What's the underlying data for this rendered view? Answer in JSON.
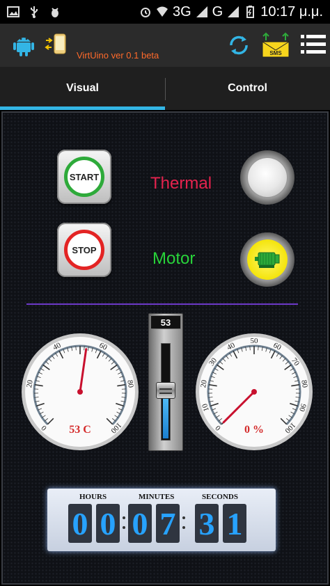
{
  "status_bar": {
    "network": "3G",
    "network2": "G",
    "time": "10:17 μ.μ."
  },
  "app_bar": {
    "title": "VirtUino ver 0.1 beta",
    "sms_label": "SMS",
    "icons": [
      "android-icon",
      "phone-link-icon",
      "sync-icon",
      "sms-icon",
      "menu-icon"
    ],
    "title_color": "#ff6a2b"
  },
  "tabs": [
    {
      "label": "Visual",
      "active": true
    },
    {
      "label": "Control",
      "active": false
    }
  ],
  "controls": {
    "start_label": "START",
    "stop_label": "STOP",
    "thermal_label": "Thermal",
    "motor_label": "Motor",
    "thermal_color": "#e5234e",
    "motor_color": "#28d33a"
  },
  "gauges": [
    {
      "value": 53,
      "readout": "53 C",
      "min": 0,
      "max": 100,
      "ticks": [
        "0",
        "20",
        "40",
        "60",
        "80",
        "100"
      ]
    },
    {
      "value": 0,
      "readout": "0 %",
      "min": 0,
      "max": 100,
      "ticks": [
        "0",
        "10",
        "20",
        "30",
        "40",
        "50",
        "60",
        "70",
        "80",
        "90",
        "100"
      ]
    }
  ],
  "slider": {
    "value": "53",
    "fraction": 0.53
  },
  "timer": {
    "hours_label": "HOURS",
    "minutes_label": "MINUTES",
    "seconds_label": "SECONDS",
    "digits": [
      "0",
      "0",
      "0",
      "7",
      "3",
      "1"
    ]
  }
}
